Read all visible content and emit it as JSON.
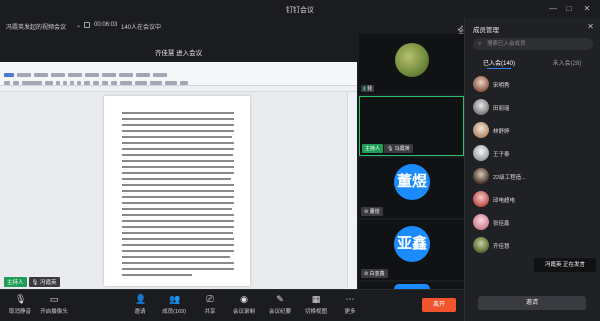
{
  "window": {
    "title": "钉钉会议"
  },
  "infobar": {
    "meeting_name": "冯霞英发起的视频会议",
    "timer": "00:06:03",
    "participants_in_meeting": "140人在会议中",
    "fullscreen_label": "全屏"
  },
  "stage": {
    "share_title": "齐佳慧 进入会议",
    "presenter_tag": "主持人",
    "presenter_name": "冯霞英"
  },
  "video_tiles": [
    {
      "name": "我",
      "avatar_text": "",
      "role": "",
      "type": "photo"
    },
    {
      "name": "冯霞英",
      "avatar_text": "",
      "role": "主持人",
      "type": "blank"
    },
    {
      "name": "董煜",
      "avatar_text": "董煜",
      "role": "",
      "type": "initials"
    },
    {
      "name": "白亚鑫",
      "avatar_text": "亚鑫",
      "role": "",
      "type": "initials"
    }
  ],
  "controls": {
    "mute": "取消静音",
    "camera": "开启摄像头",
    "invite": "邀请",
    "members": "成员(169)",
    "share": "共享",
    "recording": "会议录制",
    "minutes": "会议纪要",
    "layout": "切换视图",
    "more": "更多",
    "leave": "离开"
  },
  "panel": {
    "title": "成员管理",
    "search_placeholder": "搜索已入会成员",
    "tab_joined": "已入会(140)",
    "tab_not_joined": "未入会(28)",
    "members": [
      {
        "name": "宋明秀",
        "avatar": "photo"
      },
      {
        "name": "田丽瑶",
        "avatar": "photo"
      },
      {
        "name": "林舒婷",
        "avatar": "photo"
      },
      {
        "name": "王子泰",
        "avatar": "photo"
      },
      {
        "name": "22级工程造...",
        "avatar": "photo"
      },
      {
        "name": "邱电超电",
        "avatar": "photo"
      },
      {
        "name": "张佳鑫",
        "avatar": "photo"
      },
      {
        "name": "齐佳慧",
        "avatar": "photo"
      }
    ],
    "speaking_tip": "冯霞英 正在发言",
    "invite_button": "邀请"
  },
  "colors": {
    "leave": "#f2542d",
    "host_tag": "#1f9d57",
    "avatar_blue": "#1a8cff",
    "tab_accent": "#2f7cf6"
  }
}
